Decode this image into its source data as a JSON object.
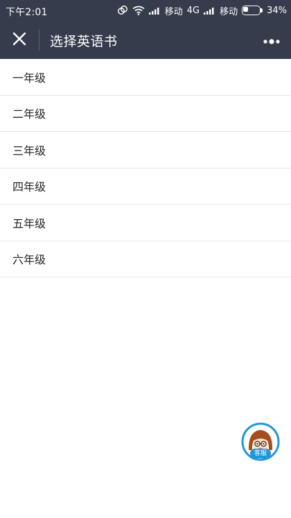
{
  "status_bar": {
    "time": "下午2:01",
    "carrier1": "移动",
    "network": "4G",
    "carrier2": "移动",
    "battery_percent": "34%",
    "battery_level": 0.34
  },
  "nav": {
    "title": "选择英语书",
    "close_icon": "close-icon",
    "more_icon": "more-dots-icon"
  },
  "grades": [
    {
      "label": "一年级"
    },
    {
      "label": "二年级"
    },
    {
      "label": "三年级"
    },
    {
      "label": "四年级"
    },
    {
      "label": "五年级"
    },
    {
      "label": "六年级"
    }
  ],
  "customer_service": {
    "label": "客服",
    "icon": "customer-service-avatar-icon"
  },
  "colors": {
    "header_bg": "#363c4c",
    "bubble_border": "#2196d8"
  }
}
